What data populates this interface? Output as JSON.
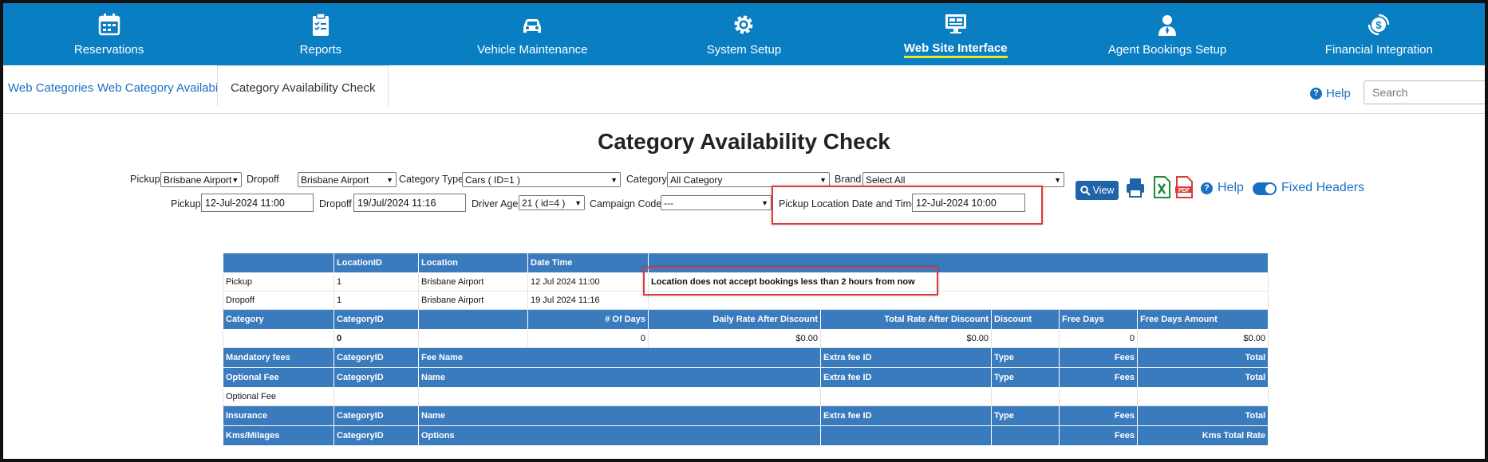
{
  "nav": [
    {
      "label": "Reservations",
      "icon": "calendar-icon"
    },
    {
      "label": "Reports",
      "icon": "clipboard-icon"
    },
    {
      "label": "Vehicle Maintenance",
      "icon": "car-icon"
    },
    {
      "label": "System Setup",
      "icon": "gear-icon"
    },
    {
      "label": "Web Site Interface",
      "icon": "monitor-icon",
      "active": true
    },
    {
      "label": "Agent Bookings Setup",
      "icon": "agent-icon"
    },
    {
      "label": "Financial Integration",
      "icon": "dollar-sync-icon"
    }
  ],
  "tabs": [
    "Web Categories",
    "Web Category Availability",
    "Category Availability Check"
  ],
  "help_label": "Help",
  "search_placeholder": "Search",
  "title": "Category Availability Check",
  "filters": {
    "pickup_label": "Pickup",
    "pickup_value": "Brisbane Airport",
    "dropoff_label": "Dropoff",
    "dropoff_value": "Brisbane Airport",
    "category_type_label": "Category Type",
    "category_type_value": "Cars ( ID=1 )",
    "category_label": "Category",
    "category_value": "All Category",
    "brand_label": "Brand",
    "brand_value": "Select All",
    "pickup_date_label": "Pickup",
    "pickup_date_value": "12-Jul-2024 11:00",
    "dropoff_date_label": "Dropoff",
    "dropoff_date_value": "19/Jul/2024 11:16",
    "driver_age_label": "Driver Age",
    "driver_age_value": "21 ( id=4 )",
    "campaign_label": "Campaign Code",
    "campaign_value": "---",
    "pickup_loc_dt_label": "Pickup Location Date and Time",
    "pickup_loc_dt_value": "12-Jul-2024 10:00"
  },
  "toolbar": {
    "view_label": "View",
    "help_label": "Help",
    "fixed_headers_label": "Fixed Headers"
  },
  "table": {
    "loc_header": [
      "",
      "LocationID",
      "Location",
      "Date Time"
    ],
    "pickup_row": [
      "Pickup",
      "1",
      "Brisbane Airport",
      "12 Jul 2024 11:00"
    ],
    "message": "Location does not accept bookings less than 2 hours from now",
    "dropoff_row": [
      "Dropoff",
      "1",
      "Brisbane Airport",
      "19 Jul 2024 11:16"
    ],
    "cat_header": [
      "Category",
      "CategoryID",
      "",
      "# Of Days",
      "Daily Rate After Discount",
      "Total Rate After Discount",
      "Discount",
      "Free Days",
      "Free Days Amount"
    ],
    "cat_row": [
      "",
      "0",
      "",
      "0",
      "$0.00",
      "$0.00",
      "",
      "0",
      "$0.00"
    ],
    "mandatory_header": [
      "Mandatory fees",
      "CategoryID",
      "Fee Name",
      "Extra fee ID",
      "Type",
      "Fees",
      "Total"
    ],
    "optional_header": [
      "Optional Fee",
      "CategoryID",
      "Name",
      "Extra fee ID",
      "Type",
      "Fees",
      "Total"
    ],
    "optional_row": "Optional Fee",
    "insurance_header": [
      "Insurance",
      "CategoryID",
      "Name",
      "Extra fee ID",
      "Type",
      "Fees",
      "Total"
    ],
    "kms_header": [
      "Kms/Milages",
      "CategoryID",
      "Options",
      "",
      "",
      "Fees",
      "Kms Total Rate"
    ]
  }
}
